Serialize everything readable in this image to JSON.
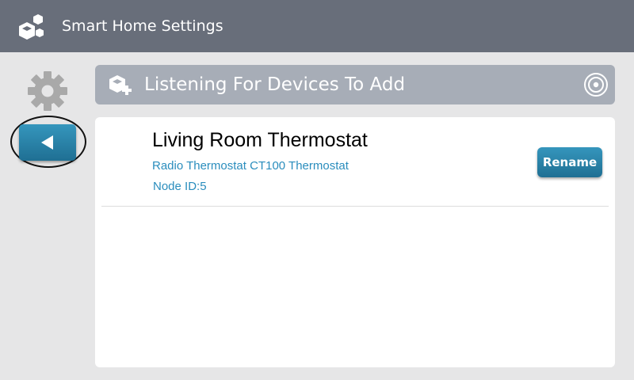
{
  "header": {
    "title": "Smart Home Settings",
    "logo_icon": "cubes-logo-icon"
  },
  "sidebar": {
    "settings_icon": "gear-icon",
    "back_icon": "triangle-left-icon"
  },
  "status": {
    "text": "Listening For Devices To Add",
    "icon": "add-device-icon",
    "spinner_icon": "listening-target-icon"
  },
  "devices": [
    {
      "name": "Living Room Thermostat",
      "model": "Radio Thermostat CT100 Thermostat",
      "node": "Node ID:5",
      "action_label": "Rename"
    }
  ],
  "colors": {
    "header_bg": "#686e7a",
    "status_bar_bg": "#a7adb7",
    "accent_blue": "#2a8dbd",
    "page_bg": "#e6e6e7"
  }
}
